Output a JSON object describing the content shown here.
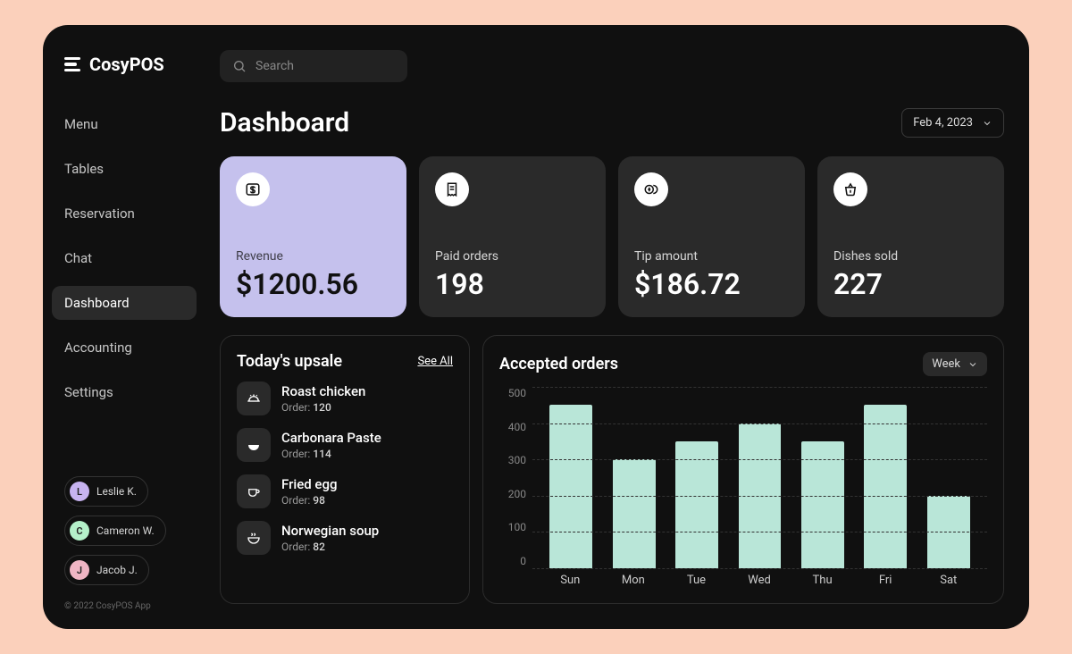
{
  "brand": "CosyPOS",
  "search": {
    "placeholder": "Search"
  },
  "nav": {
    "items": [
      {
        "label": "Menu",
        "active": false
      },
      {
        "label": "Tables",
        "active": false
      },
      {
        "label": "Reservation",
        "active": false
      },
      {
        "label": "Chat",
        "active": false
      },
      {
        "label": "Dashboard",
        "active": true
      },
      {
        "label": "Accounting",
        "active": false
      },
      {
        "label": "Settings",
        "active": false
      }
    ]
  },
  "users": [
    {
      "initial": "L",
      "name": "Leslie K.",
      "color": "#c7b3f0"
    },
    {
      "initial": "C",
      "name": "Cameron W.",
      "color": "#b4f0c9"
    },
    {
      "initial": "J",
      "name": "Jacob J.",
      "color": "#f0b5c4"
    }
  ],
  "footer": "© 2022 CosyPOS App",
  "page_title": "Dashboard",
  "date_selector": "Feb 4, 2023",
  "stats": [
    {
      "icon": "dollar-icon",
      "label": "Revenue",
      "value": "$1200.56",
      "accent": true
    },
    {
      "icon": "receipt-icon",
      "label": "Paid orders",
      "value": "198",
      "accent": false
    },
    {
      "icon": "tip-icon",
      "label": "Tip amount",
      "value": "$186.72",
      "accent": false
    },
    {
      "icon": "basket-icon",
      "label": "Dishes sold",
      "value": "227",
      "accent": false
    }
  ],
  "upsale": {
    "title": "Today's upsale",
    "see_all": "See All",
    "order_prefix": "Order:",
    "items": [
      {
        "name": "Roast chicken",
        "order": "120",
        "icon": "dish-platter-icon"
      },
      {
        "name": "Carbonara Paste",
        "order": "114",
        "icon": "bowl-icon"
      },
      {
        "name": "Fried egg",
        "order": "98",
        "icon": "cup-icon"
      },
      {
        "name": "Norwegian soup",
        "order": "82",
        "icon": "soup-icon"
      }
    ]
  },
  "orders_panel": {
    "title": "Accepted orders",
    "range_label": "Week"
  },
  "chart_data": {
    "type": "bar",
    "categories": [
      "Sun",
      "Mon",
      "Tue",
      "Wed",
      "Thu",
      "Fri",
      "Sat"
    ],
    "values": [
      450,
      300,
      350,
      400,
      350,
      450,
      200
    ],
    "y_ticks": [
      500,
      400,
      300,
      200,
      100,
      0
    ],
    "ylim": [
      0,
      500
    ],
    "bar_color": "#b9e6d8",
    "title": "Accepted orders",
    "xlabel": "",
    "ylabel": ""
  }
}
